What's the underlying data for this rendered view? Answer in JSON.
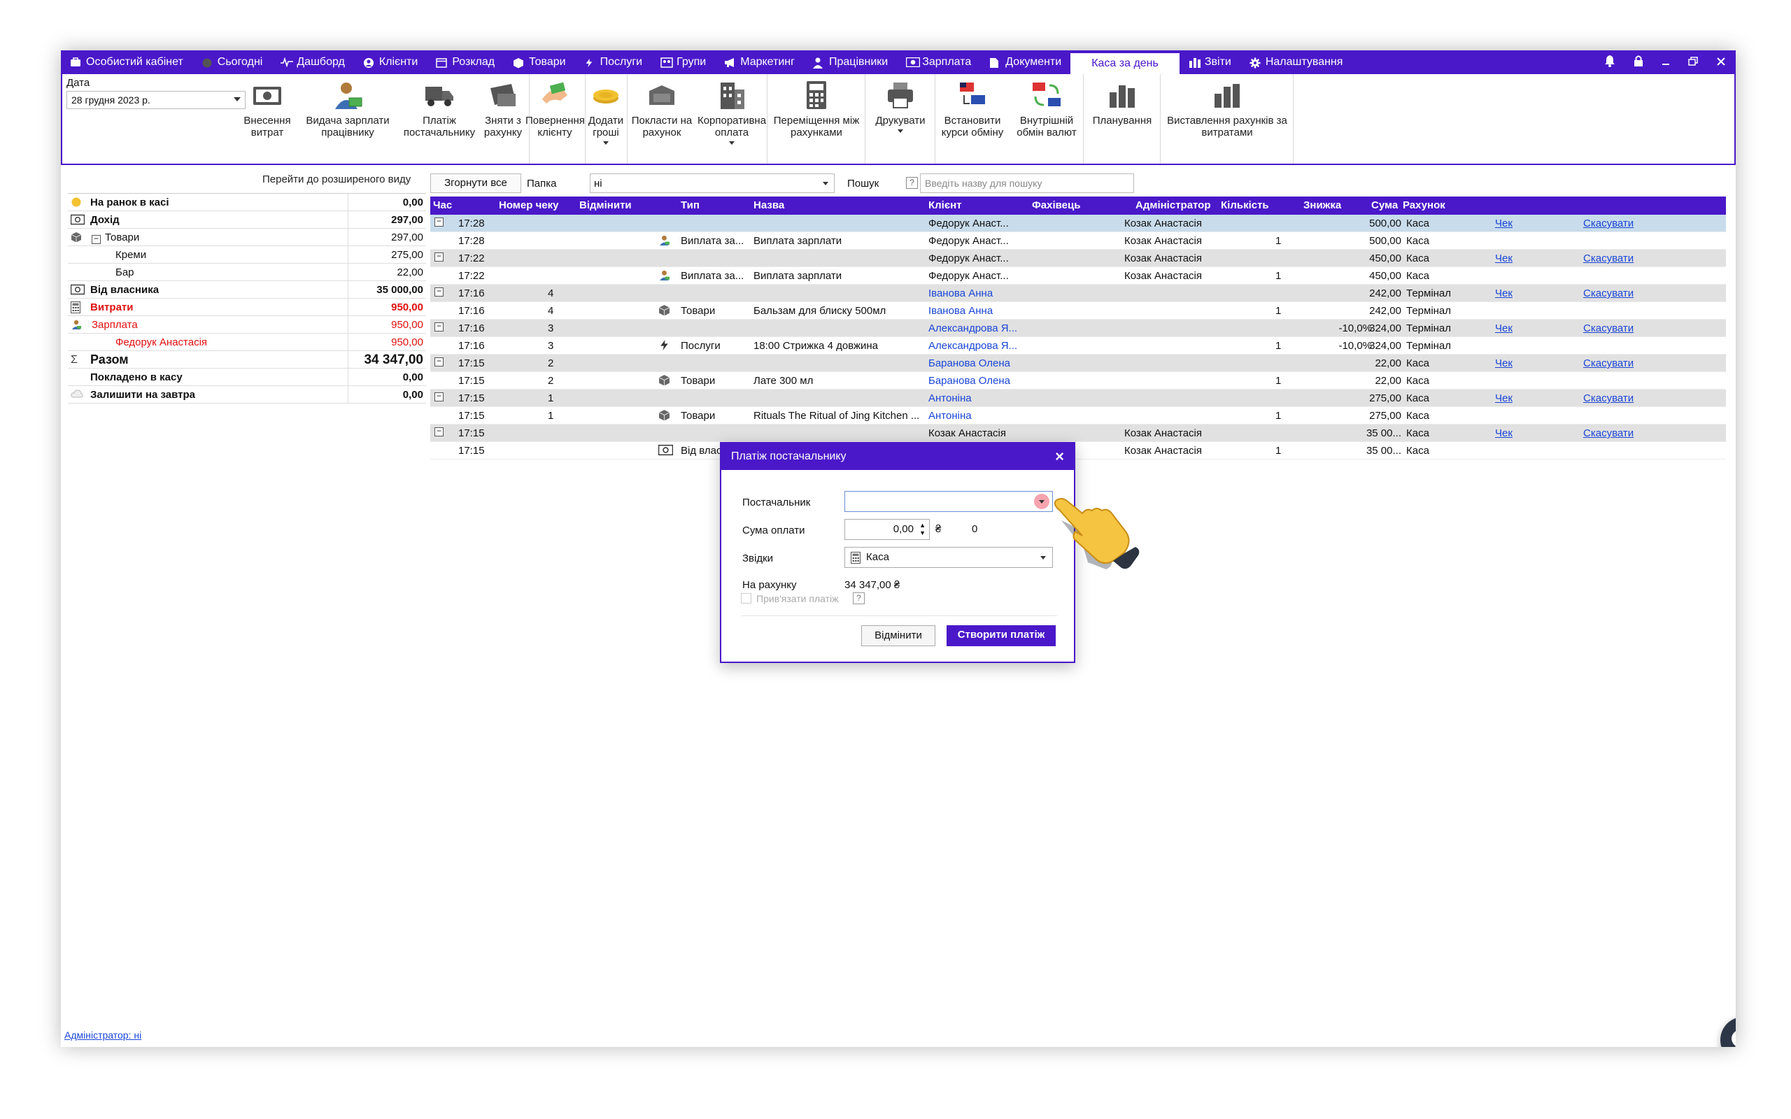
{
  "colors": {
    "accent": "#4a18c9",
    "link": "#1a46d6",
    "expense": "#e01010"
  },
  "menu": {
    "tabs": [
      {
        "label": "Особистий кабінет",
        "icon": "cabinet-icon"
      },
      {
        "label": "Сьогодні",
        "icon": "today-icon"
      },
      {
        "label": "Дашборд",
        "icon": "pulse-icon"
      },
      {
        "label": "Клієнти",
        "icon": "user-circle-icon"
      },
      {
        "label": "Розклад",
        "icon": "calendar-icon"
      },
      {
        "label": "Товари",
        "icon": "box-icon"
      },
      {
        "label": "Послуги",
        "icon": "lightning-icon"
      },
      {
        "label": "Групи",
        "icon": "groups-icon"
      },
      {
        "label": "Маркетинг",
        "icon": "megaphone-icon"
      },
      {
        "label": "Працівники",
        "icon": "person-icon"
      },
      {
        "label": "Зарплата",
        "icon": "money-icon"
      },
      {
        "label": "Документи",
        "icon": "document-icon"
      },
      {
        "label": "Каса за день",
        "icon": ""
      },
      {
        "label": "Звіти",
        "icon": "bar-chart-icon"
      },
      {
        "label": "Налаштування",
        "icon": "gear-icon"
      }
    ],
    "active": "Каса за день",
    "window_controls": [
      "bell-icon",
      "lock-icon",
      "minimize-icon",
      "restore-icon",
      "close-icon"
    ]
  },
  "toolbar": {
    "date_label": "Дата",
    "date_value": "28 грудня  2023 р.",
    "buttons": [
      {
        "label": "Внесення витрат",
        "icon": "cash-icon"
      },
      {
        "label": "Видача зарплати працівнику",
        "icon": "salary-icon"
      },
      {
        "label": "Платіж постачальнику",
        "icon": "truck-icon"
      },
      {
        "label": "Зняти з рахунку",
        "icon": "withdraw-icon"
      },
      {
        "label": "Повернення клієнту",
        "icon": "refund-icon"
      },
      {
        "label": "Додати гроші",
        "icon": "coins-icon"
      },
      {
        "label": "Покласти на рахунок",
        "icon": "deposit-icon"
      },
      {
        "label": "Корпоративна оплата",
        "icon": "building-icon"
      },
      {
        "label": "Переміщення між рахунками",
        "icon": "calculator-icon"
      },
      {
        "label": "Друкувати",
        "icon": "printer-icon"
      },
      {
        "label": "Встановити курси обміну",
        "icon": "exchange-rate-icon"
      },
      {
        "label": "Внутрішній обмін валют",
        "icon": "currency-swap-icon"
      },
      {
        "label": "Планування",
        "icon": "planning-chart-icon"
      },
      {
        "label": "Виставлення рахунків за витратами",
        "icon": "invoice-chart-icon"
      }
    ]
  },
  "summary": {
    "advanced_link": "Перейти до розширеного виду",
    "rows": [
      {
        "label": "На ранок в касі",
        "value": "0,00",
        "icon": "morning-icon",
        "style": "bold",
        "indent": 0
      },
      {
        "label": "Дохід",
        "value": "297,00",
        "icon": "cash-icon",
        "style": "bold",
        "indent": 0
      },
      {
        "label": "Товари",
        "value": "297,00",
        "icon": "box-icon",
        "style": "tree",
        "indent": 1
      },
      {
        "label": "Креми",
        "value": "275,00",
        "icon": "",
        "style": "",
        "indent": 2
      },
      {
        "label": "Бар",
        "value": "22,00",
        "icon": "",
        "style": "",
        "indent": 2
      },
      {
        "label": "Від власника",
        "value": "35 000,00",
        "icon": "cash-icon",
        "style": "bold",
        "indent": 0
      },
      {
        "label": "Витрати",
        "value": "950,00",
        "icon": "calculator-icon",
        "style": "bold red",
        "indent": 0
      },
      {
        "label": "Зарплата",
        "value": "950,00",
        "icon": "salary-small-icon",
        "style": "red",
        "indent": 1
      },
      {
        "label": "Федорук Анастасія",
        "value": "950,00",
        "icon": "",
        "style": "red",
        "indent": 2
      },
      {
        "label": "Разом",
        "value": "34 347,00",
        "icon": "sigma-icon",
        "style": "bold big",
        "indent": 0
      },
      {
        "label": "Покладено в касу",
        "value": "0,00",
        "icon": "",
        "style": "bold",
        "indent": 0
      },
      {
        "label": "Залишити на завтра",
        "value": "0,00",
        "icon": "tomorrow-icon",
        "style": "bold",
        "indent": 0
      }
    ]
  },
  "filter": {
    "collapse_all": "Згорнути все",
    "folder_label": "Папка",
    "folder_value": "ні",
    "search_label": "Пошук",
    "search_help": "?",
    "search_placeholder": "Введіть назву для пошуку"
  },
  "grid": {
    "columns": [
      "Час",
      "Номер чеку",
      "Відмінити",
      "Тип",
      "Назва",
      "Клієнт",
      "Фахівець",
      "Адміністратор",
      "Кількість",
      "Знижка",
      "Сума",
      "Рахунок"
    ],
    "rows": [
      {
        "grp": true,
        "sel": true,
        "time": "17:28",
        "num": "",
        "type": "",
        "type_icon": "",
        "name": "",
        "client": "Федорук Анаст...",
        "client_blue": false,
        "admin": "Козак Анастасія",
        "qty": "",
        "disc": "",
        "sum": "500,00",
        "acc": "Каса",
        "check": "Чек",
        "cancel": "Скасувати"
      },
      {
        "grp": false,
        "time": "17:28",
        "num": "",
        "type": "Виплата за...",
        "type_icon": "salary-small-icon",
        "name": "Виплата зарплати",
        "client": "Федорук Анаст...",
        "client_blue": false,
        "admin": "Козак Анастасія",
        "qty": "1",
        "disc": "",
        "sum": "500,00",
        "acc": "Каса",
        "check": "",
        "cancel": ""
      },
      {
        "grp": true,
        "time": "17:22",
        "num": "",
        "type": "",
        "type_icon": "",
        "name": "",
        "client": "Федорук Анаст...",
        "client_blue": false,
        "admin": "Козак Анастасія",
        "qty": "",
        "disc": "",
        "sum": "450,00",
        "acc": "Каса",
        "check": "Чек",
        "cancel": "Скасувати"
      },
      {
        "grp": false,
        "time": "17:22",
        "num": "",
        "type": "Виплата за...",
        "type_icon": "salary-small-icon",
        "name": "Виплата зарплати",
        "client": "Федорук Анаст...",
        "client_blue": false,
        "admin": "Козак Анастасія",
        "qty": "1",
        "disc": "",
        "sum": "450,00",
        "acc": "Каса",
        "check": "",
        "cancel": ""
      },
      {
        "grp": true,
        "time": "17:16",
        "num": "4",
        "type": "",
        "type_icon": "",
        "name": "",
        "client": "Іванова Анна",
        "client_blue": true,
        "admin": "",
        "qty": "",
        "disc": "",
        "sum": "242,00",
        "acc": "Термінал",
        "check": "Чек",
        "cancel": "Скасувати"
      },
      {
        "grp": false,
        "time": "17:16",
        "num": "4",
        "type": "Товари",
        "type_icon": "box-icon",
        "name": "Бальзам для блиску 500мл",
        "client": "Іванова Анна",
        "client_blue": true,
        "admin": "",
        "qty": "1",
        "disc": "",
        "sum": "242,00",
        "acc": "Термінал",
        "check": "",
        "cancel": ""
      },
      {
        "grp": true,
        "time": "17:16",
        "num": "3",
        "type": "",
        "type_icon": "",
        "name": "",
        "client": "Александрова Я...",
        "client_blue": true,
        "admin": "",
        "qty": "",
        "disc": "-10,0%",
        "sum": "324,00",
        "acc": "Термінал",
        "check": "Чек",
        "cancel": "Скасувати"
      },
      {
        "grp": false,
        "time": "17:16",
        "num": "3",
        "type": "Послуги",
        "type_icon": "lightning-icon",
        "name": "18:00 Стрижка 4 довжина",
        "client": "Александрова Я...",
        "client_blue": true,
        "admin": "",
        "qty": "1",
        "disc": "-10,0%",
        "sum": "324,00",
        "acc": "Термінал",
        "check": "",
        "cancel": ""
      },
      {
        "grp": true,
        "time": "17:15",
        "num": "2",
        "type": "",
        "type_icon": "",
        "name": "",
        "client": "Баранова Олена",
        "client_blue": true,
        "admin": "",
        "qty": "",
        "disc": "",
        "sum": "22,00",
        "acc": "Каса",
        "check": "Чек",
        "cancel": "Скасувати"
      },
      {
        "grp": false,
        "time": "17:15",
        "num": "2",
        "type": "Товари",
        "type_icon": "box-icon",
        "name": "Лате 300 мл",
        "client": "Баранова Олена",
        "client_blue": true,
        "admin": "",
        "qty": "1",
        "disc": "",
        "sum": "22,00",
        "acc": "Каса",
        "check": "",
        "cancel": ""
      },
      {
        "grp": true,
        "time": "17:15",
        "num": "1",
        "type": "",
        "type_icon": "",
        "name": "",
        "client": "Антоніна",
        "client_blue": true,
        "admin": "",
        "qty": "",
        "disc": "",
        "sum": "275,00",
        "acc": "Каса",
        "check": "Чек",
        "cancel": "Скасувати"
      },
      {
        "grp": false,
        "time": "17:15",
        "num": "1",
        "type": "Товари",
        "type_icon": "box-icon",
        "name": "Rituals The Ritual of Jing Kitchen ...",
        "client": "Антоніна",
        "client_blue": true,
        "admin": "",
        "qty": "1",
        "disc": "",
        "sum": "275,00",
        "acc": "Каса",
        "check": "",
        "cancel": ""
      },
      {
        "grp": true,
        "time": "17:15",
        "num": "",
        "type": "",
        "type_icon": "",
        "name": "",
        "client": "Козак Анастасія",
        "client_blue": false,
        "admin": "Козак Анастасія",
        "qty": "",
        "disc": "",
        "sum": "35 00...",
        "acc": "Каса",
        "check": "Чек",
        "cancel": "Скасувати"
      },
      {
        "grp": false,
        "time": "17:15",
        "num": "",
        "type": "Від власн...",
        "type_icon": "cash-icon",
        "name": "",
        "client": "",
        "client_blue": false,
        "admin": "Козак Анастасія",
        "qty": "1",
        "disc": "",
        "sum": "35 00...",
        "acc": "Каса",
        "check": "",
        "cancel": ""
      }
    ]
  },
  "dialog": {
    "title": "Платіж постачальнику",
    "supplier_label": "Постачальник",
    "supplier_value": "",
    "amount_label": "Сума оплати",
    "amount_value": "0,00",
    "currency": "₴",
    "amount_extra": "0",
    "source_label": "Звідки",
    "source_value": "Каса",
    "balance_label": "На рахунку",
    "balance_value": "34 347,00 ₴",
    "link_label": "Прив'язати платіж",
    "help": "?",
    "cancel_label": "Відмінити",
    "create_label": "Створити платіж"
  },
  "footer": {
    "admin_link": "Адміністратор: ні"
  }
}
